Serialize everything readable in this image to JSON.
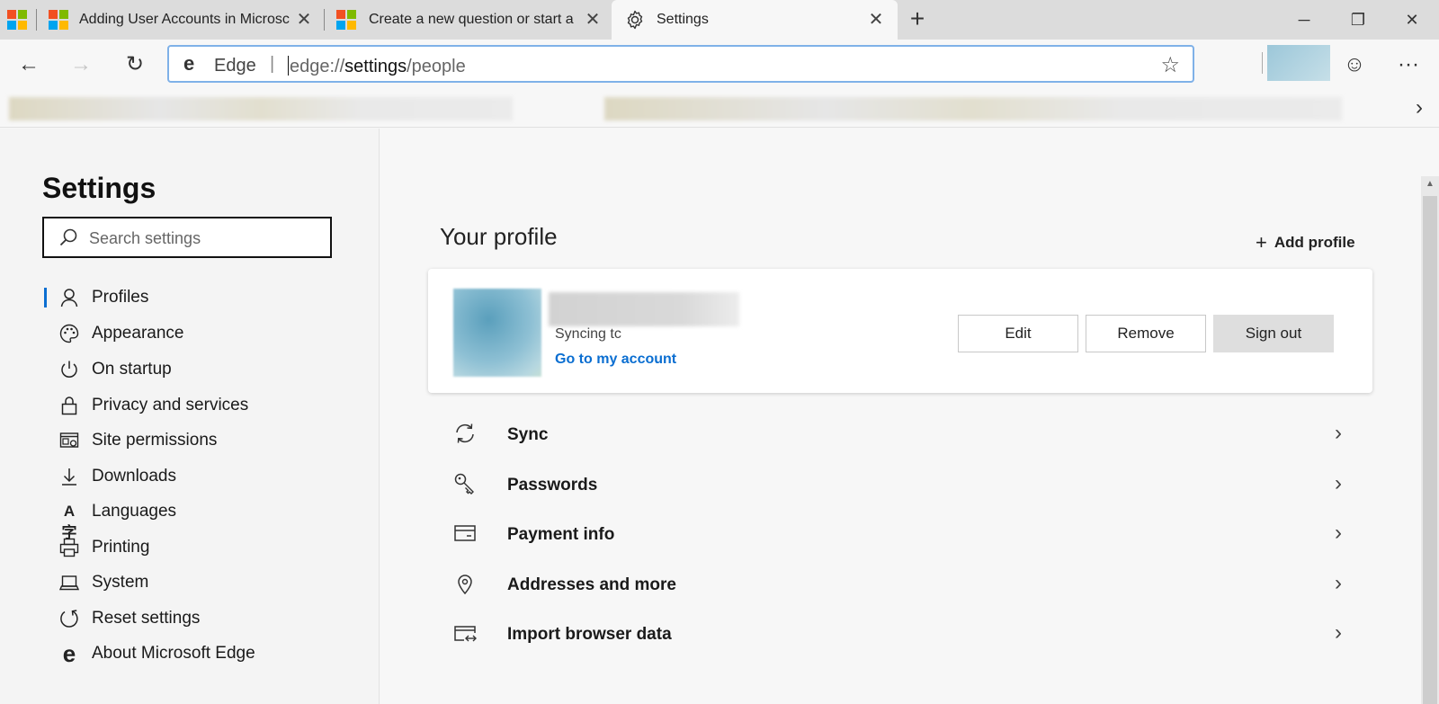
{
  "tabs": [
    {
      "title": "Adding User Accounts in Microsc",
      "icon": "microsoft-logo-icon"
    },
    {
      "title": "Create a new question or start a",
      "icon": "microsoft-logo-icon"
    },
    {
      "title": "Settings",
      "icon": "gear-icon",
      "active": true
    }
  ],
  "address": {
    "brand": "Edge",
    "separator": "|",
    "url_prefix": "edge://",
    "url_host": "settings",
    "url_path": "/people"
  },
  "sidebar": {
    "title": "Settings",
    "search_placeholder": "Search settings",
    "items": [
      {
        "label": "Profiles",
        "icon": "person-icon",
        "active": true
      },
      {
        "label": "Appearance",
        "icon": "palette-icon"
      },
      {
        "label": "On startup",
        "icon": "power-icon"
      },
      {
        "label": "Privacy and services",
        "icon": "lock-icon"
      },
      {
        "label": "Site permissions",
        "icon": "site-permissions-icon"
      },
      {
        "label": "Downloads",
        "icon": "download-icon"
      },
      {
        "label": "Languages",
        "icon": "languages-icon"
      },
      {
        "label": "Printing",
        "icon": "printer-icon"
      },
      {
        "label": "System",
        "icon": "laptop-icon"
      },
      {
        "label": "Reset settings",
        "icon": "reset-icon"
      },
      {
        "label": "About Microsoft Edge",
        "icon": "edge-logo-icon"
      }
    ]
  },
  "main": {
    "section_title": "Your profile",
    "add_profile_label": "Add profile",
    "profile": {
      "syncing_text": "Syncing tc",
      "account_link": "Go to my account",
      "buttons": {
        "edit": "Edit",
        "remove": "Remove",
        "sign_out": "Sign out"
      }
    },
    "rows": [
      {
        "label": "Sync",
        "icon": "sync-icon"
      },
      {
        "label": "Passwords",
        "icon": "key-icon"
      },
      {
        "label": "Payment info",
        "icon": "credit-card-icon"
      },
      {
        "label": "Addresses and more",
        "icon": "location-pin-icon"
      },
      {
        "label": "Import browser data",
        "icon": "import-icon"
      }
    ]
  },
  "colors": {
    "accent": "#0a6ed1",
    "omnibox_border": "#7fb1e8"
  }
}
